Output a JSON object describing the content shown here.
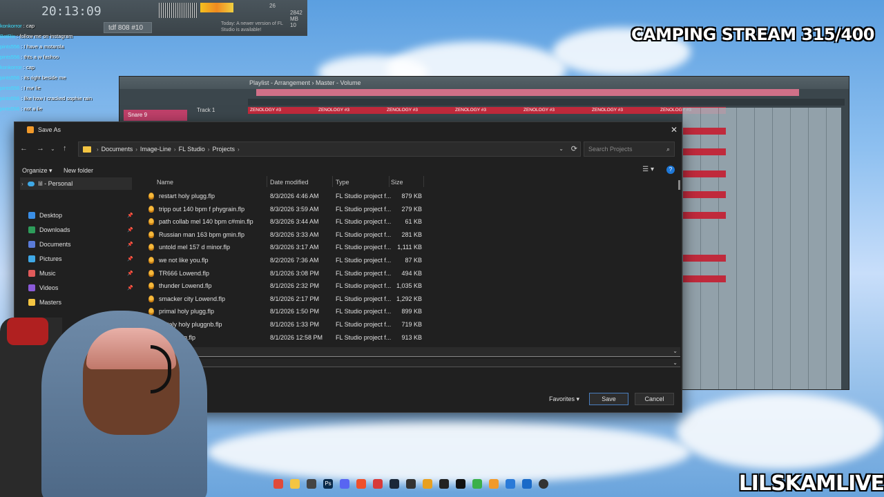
{
  "overlay": {
    "stream_title": "CAMPING STREAM 315/400",
    "brand": "LILSKAMLIVE"
  },
  "fl_top": {
    "time": "20:13:09",
    "pattern": "tdf 808 #10",
    "cpu_top": "26",
    "mem": "2842 MB",
    "voices": "10",
    "hint": "Today: A newer version of FL Studio is available!"
  },
  "chat": [
    {
      "user": "konkorror",
      "msg": "cap"
    },
    {
      "user": "BotRix",
      "msg": "follow me on instagram"
    },
    {
      "user": "pints556",
      "msg": "I have a motarola"
    },
    {
      "user": "pints556",
      "msg": "thts a w fashoo"
    },
    {
      "user": "konkorror",
      "msg": "cap"
    },
    {
      "user": "pints556",
      "msg": "its right beside me"
    },
    {
      "user": "pints556",
      "msg": "I nvr lie"
    },
    {
      "user": "pints556",
      "msg": "like how I cracked sophie rain"
    },
    {
      "user": "pints556",
      "msg": "not a lie"
    }
  ],
  "playlist": {
    "title": "Playlist - Arrangement  ›  Master - Volume",
    "track_label": "Snare 9",
    "track1": "Track 1",
    "clip_label": "ZENOLOGY #3"
  },
  "dialog": {
    "title": "Save As",
    "breadcrumbs": [
      "Documents",
      "Image-Line",
      "FL Studio",
      "Projects"
    ],
    "search_placeholder": "Search Projects",
    "organize": "Organize",
    "new_folder": "New folder",
    "nav_personal": "lil - Personal",
    "nav_items": [
      {
        "label": "Desktop",
        "color": "#3a8ee6"
      },
      {
        "label": "Downloads",
        "color": "#2d9c5a"
      },
      {
        "label": "Documents",
        "color": "#5a7bd8"
      },
      {
        "label": "Pictures",
        "color": "#3fa8e6"
      },
      {
        "label": "Music",
        "color": "#e05a5a"
      },
      {
        "label": "Videos",
        "color": "#8a5ad8"
      },
      {
        "label": "Masters",
        "color": "#f4c542"
      }
    ],
    "columns": {
      "name": "Name",
      "date": "Date modified",
      "type": "Type",
      "size": "Size"
    },
    "files": [
      {
        "name": "restart holy plugg.flp",
        "date": "8/3/2026 4:46 AM",
        "type": "FL Studio project f...",
        "size": "879 KB"
      },
      {
        "name": "tripp out 140 bpm f phygrain.flp",
        "date": "8/3/2026 3:59 AM",
        "type": "FL Studio project f...",
        "size": "279 KB"
      },
      {
        "name": "path collab mel 140 bpm c#min.flp",
        "date": "8/3/2026 3:44 AM",
        "type": "FL Studio project f...",
        "size": "61 KB"
      },
      {
        "name": "Russian man 163 bpm gmin.flp",
        "date": "8/3/2026 3:33 AM",
        "type": "FL Studio project f...",
        "size": "281 KB"
      },
      {
        "name": "untold mel 157 d minor.flp",
        "date": "8/3/2026 3:17 AM",
        "type": "FL Studio project f...",
        "size": "1,111 KB"
      },
      {
        "name": "we not like you.flp",
        "date": "8/2/2026 7:36 AM",
        "type": "FL Studio project f...",
        "size": "87 KB"
      },
      {
        "name": "TR666 Lowend.flp",
        "date": "8/1/2026 3:08 PM",
        "type": "FL Studio project f...",
        "size": "494 KB"
      },
      {
        "name": "thunder Lowend.flp",
        "date": "8/1/2026 2:32 PM",
        "type": "FL Studio project f...",
        "size": "1,035 KB"
      },
      {
        "name": "smacker city Lowend.flp",
        "date": "8/1/2026 2:17 PM",
        "type": "FL Studio project f...",
        "size": "1,292 KB"
      },
      {
        "name": "primal holy plugg.flp",
        "date": "8/1/2026 1:50 PM",
        "type": "FL Studio project f...",
        "size": "899 KB"
      },
      {
        "name": "to italy holy pluggnb.flp",
        "date": "8/1/2026 1:33 PM",
        "type": "FL Studio project f...",
        "size": "719 KB"
      },
      {
        "name": "holy plugg.flp",
        "date": "8/1/2026 12:58 PM",
        "type": "FL Studio project f...",
        "size": "913 KB"
      }
    ],
    "favorites": "Favorites",
    "save": "Save",
    "cancel": "Cancel"
  }
}
